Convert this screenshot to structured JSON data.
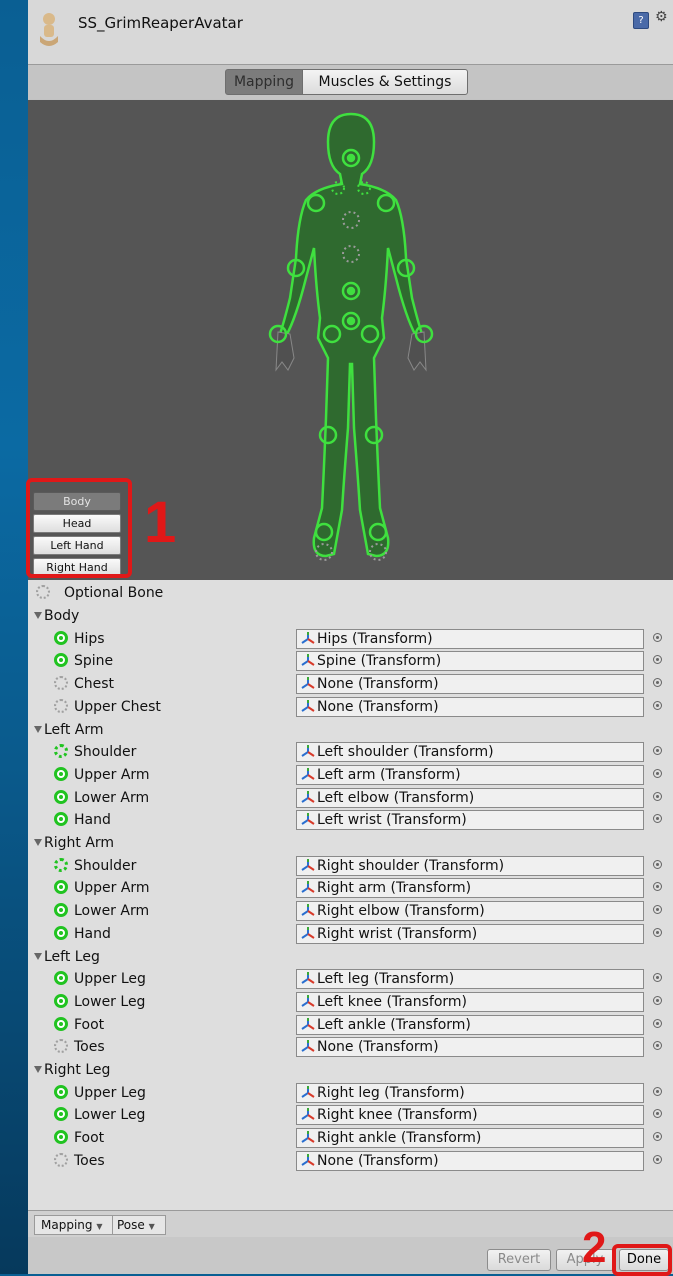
{
  "window": {
    "title": "SS_GrimReaperAvatar"
  },
  "toolbar": {
    "tabs": [
      {
        "label": "Mapping",
        "active": true
      },
      {
        "label": "Muscles & Settings",
        "active": false
      }
    ]
  },
  "body_parts": [
    {
      "label": "Body",
      "active": true
    },
    {
      "label": "Head",
      "active": false
    },
    {
      "label": "Left Hand",
      "active": false
    },
    {
      "label": "Right Hand",
      "active": false
    }
  ],
  "legend": {
    "optional_label": "Optional Bone"
  },
  "groups": [
    {
      "name": "Body",
      "bones": [
        {
          "label": "Hips",
          "value": "Hips (Transform)",
          "status": "required"
        },
        {
          "label": "Spine",
          "value": "Spine (Transform)",
          "status": "required"
        },
        {
          "label": "Chest",
          "value": "None (Transform)",
          "status": "optional"
        },
        {
          "label": "Upper Chest",
          "value": "None (Transform)",
          "status": "optional"
        }
      ]
    },
    {
      "name": "Left Arm",
      "bones": [
        {
          "label": "Shoulder",
          "value": "Left shoulder (Transform)",
          "status": "optional-assigned"
        },
        {
          "label": "Upper Arm",
          "value": "Left arm (Transform)",
          "status": "required"
        },
        {
          "label": "Lower Arm",
          "value": "Left elbow (Transform)",
          "status": "required"
        },
        {
          "label": "Hand",
          "value": "Left wrist (Transform)",
          "status": "required"
        }
      ]
    },
    {
      "name": "Right Arm",
      "bones": [
        {
          "label": "Shoulder",
          "value": "Right shoulder (Transform)",
          "status": "optional-assigned"
        },
        {
          "label": "Upper Arm",
          "value": "Right arm (Transform)",
          "status": "required"
        },
        {
          "label": "Lower Arm",
          "value": "Right elbow (Transform)",
          "status": "required"
        },
        {
          "label": "Hand",
          "value": "Right wrist (Transform)",
          "status": "required"
        }
      ]
    },
    {
      "name": "Left Leg",
      "bones": [
        {
          "label": "Upper Leg",
          "value": "Left leg (Transform)",
          "status": "required"
        },
        {
          "label": "Lower Leg",
          "value": "Left knee (Transform)",
          "status": "required"
        },
        {
          "label": "Foot",
          "value": "Left ankle (Transform)",
          "status": "required"
        },
        {
          "label": "Toes",
          "value": "None (Transform)",
          "status": "optional"
        }
      ]
    },
    {
      "name": "Right Leg",
      "bones": [
        {
          "label": "Upper Leg",
          "value": "Right leg (Transform)",
          "status": "required"
        },
        {
          "label": "Lower Leg",
          "value": "Right knee (Transform)",
          "status": "required"
        },
        {
          "label": "Foot",
          "value": "Right ankle (Transform)",
          "status": "required"
        },
        {
          "label": "Toes",
          "value": "None (Transform)",
          "status": "optional"
        }
      ]
    }
  ],
  "bottom_tabs": [
    {
      "label": "Mapping"
    },
    {
      "label": "Pose"
    }
  ],
  "footer": {
    "revert_label": "Revert",
    "apply_label": "Apply",
    "done_label": "Done"
  },
  "annotations": {
    "one": "1",
    "two": "2"
  },
  "colors": {
    "accent_red": "#e01818",
    "bone_green": "#21c321",
    "figure_fill": "#2f6a2f"
  }
}
